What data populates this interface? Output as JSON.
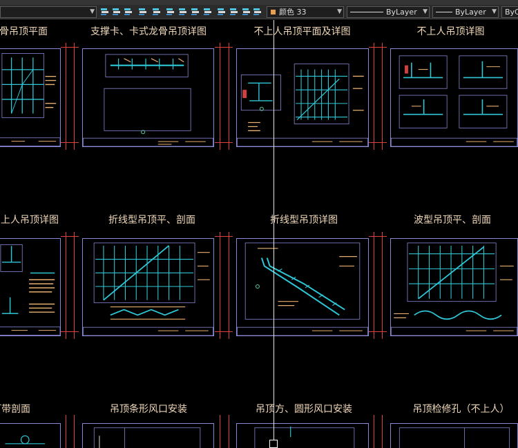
{
  "toolbar": {
    "color_value": "颜色 33",
    "color_swatch": "#e8a050",
    "linetype_value": "ByLayer",
    "lineweight_value": "ByLayer",
    "plotstyle_value": "ByC"
  },
  "colors": {
    "background": "#000000",
    "title_text": "#f0d8b8",
    "sheet_border": "#8a8ad8",
    "cyan_lines": "#2fc8d8",
    "annotation": "#e8b070",
    "marker": "#e04040",
    "crosshair": "#e8e8e8"
  },
  "sheets": [
    {
      "title": "骨吊顶平面",
      "icon": "drawing-sheet"
    },
    {
      "title": "支撑卡、卡式龙骨吊顶详图",
      "icon": "drawing-sheet"
    },
    {
      "title": "不上人吊顶平面及详图",
      "icon": "drawing-sheet"
    },
    {
      "title": "不上人吊顶详图",
      "icon": "drawing-sheet"
    },
    {
      "title": "上人吊顶详图",
      "icon": "drawing-sheet"
    },
    {
      "title": "折线型吊顶平、剖面",
      "icon": "drawing-sheet"
    },
    {
      "title": "折线型吊顶详图",
      "icon": "drawing-sheet"
    },
    {
      "title": "波型吊顶平、剖面",
      "icon": "drawing-sheet"
    },
    {
      "title": "灯带剖面",
      "icon": "drawing-sheet"
    },
    {
      "title": "吊顶条形风口安装",
      "icon": "drawing-sheet"
    },
    {
      "title": "吊顶方、圆形风口安装",
      "icon": "drawing-sheet"
    },
    {
      "title": "吊顶检修孔（不上人）",
      "icon": "drawing-sheet"
    }
  ]
}
